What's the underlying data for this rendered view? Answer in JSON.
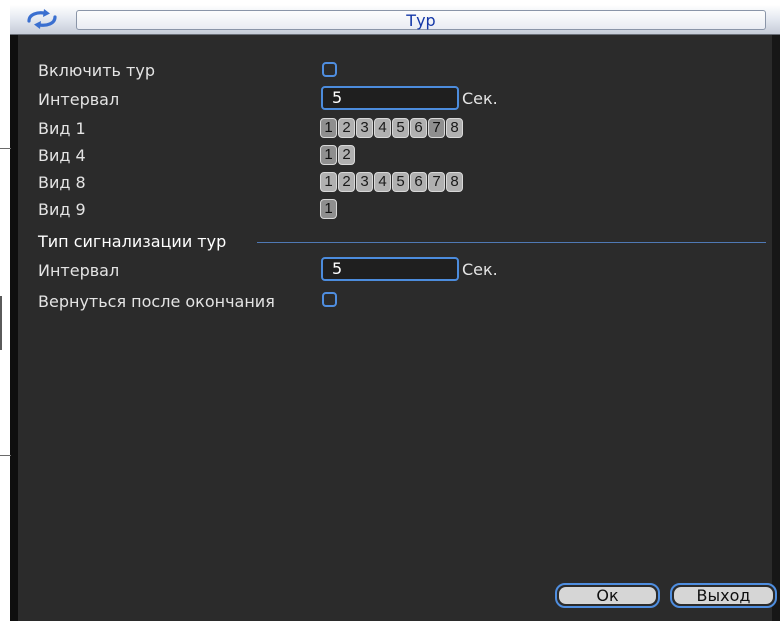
{
  "window": {
    "title": "Тур"
  },
  "settings": {
    "enable_tour_label": "Включить тур",
    "interval_label": "Интервал",
    "interval_value": "5",
    "unit": "Сек.",
    "views": [
      {
        "label": "Вид 1",
        "channels": [
          "1",
          "2",
          "3",
          "4",
          "5",
          "6",
          "7",
          "8"
        ]
      },
      {
        "label": "Вид 4",
        "channels": [
          "1",
          "2"
        ]
      },
      {
        "label": "Вид 8",
        "channels": [
          "1",
          "2",
          "3",
          "4",
          "5",
          "6",
          "7",
          "8"
        ]
      },
      {
        "label": "Вид 9",
        "channels": [
          "1"
        ]
      }
    ]
  },
  "alarm": {
    "section_title": "Тип сигнализации тур",
    "interval_label": "Интервал",
    "interval_value": "5",
    "unit": "Сек.",
    "return_label": "Вернуться после окончания"
  },
  "buttons": {
    "ok": "Ок",
    "exit": "Выход"
  },
  "colors": {
    "background": "#2b2b2b",
    "accent": "#4f8ee0",
    "title_text": "#1538a8"
  },
  "icons": {
    "title": "refresh-icon"
  }
}
